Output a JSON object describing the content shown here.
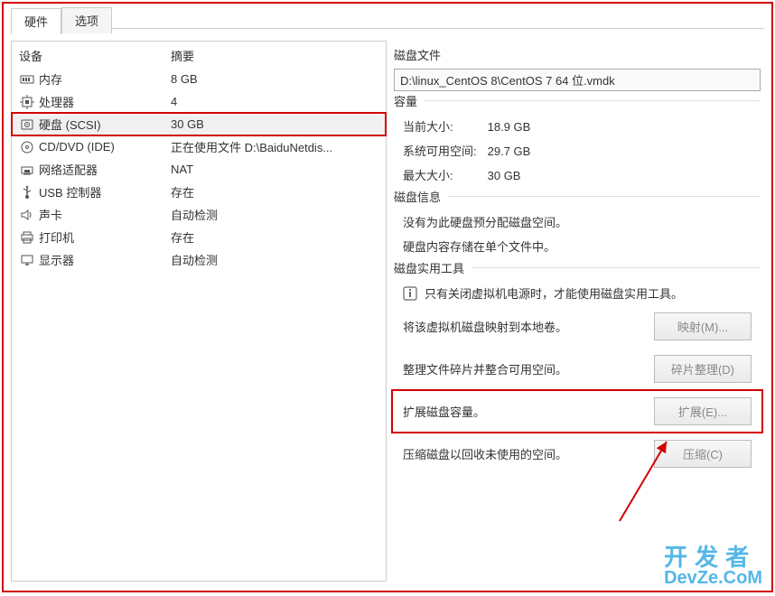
{
  "tabs": {
    "hardware": "硬件",
    "options": "选项"
  },
  "devHeader": {
    "device": "设备",
    "summary": "摘要"
  },
  "devices": [
    {
      "icon": "memory-icon",
      "name": "内存",
      "summary": "8 GB"
    },
    {
      "icon": "cpu-icon",
      "name": "处理器",
      "summary": "4"
    },
    {
      "icon": "disk-icon",
      "name": "硬盘 (SCSI)",
      "summary": "30 GB",
      "selected": true,
      "highlighted": true
    },
    {
      "icon": "cd-icon",
      "name": "CD/DVD (IDE)",
      "summary": "正在使用文件 D:\\BaiduNetdis..."
    },
    {
      "icon": "network-icon",
      "name": "网络适配器",
      "summary": "NAT"
    },
    {
      "icon": "usb-icon",
      "name": "USB 控制器",
      "summary": "存在"
    },
    {
      "icon": "sound-icon",
      "name": "声卡",
      "summary": "自动检测"
    },
    {
      "icon": "printer-icon",
      "name": "打印机",
      "summary": "存在"
    },
    {
      "icon": "display-icon",
      "name": "显示器",
      "summary": "自动检测"
    }
  ],
  "groups": {
    "diskFile": {
      "title": "磁盘文件",
      "path": "D:\\linux_CentOS 8\\CentOS 7 64 位.vmdk"
    },
    "capacity": {
      "title": "容量",
      "current": {
        "label": "当前大小:",
        "value": "18.9 GB"
      },
      "free": {
        "label": "系统可用空间:",
        "value": "29.7 GB"
      },
      "max": {
        "label": "最大大小:",
        "value": "30 GB"
      }
    },
    "diskInfo": {
      "title": "磁盘信息",
      "line1": "没有为此硬盘预分配磁盘空间。",
      "line2": "硬盘内容存储在单个文件中。"
    },
    "utilities": {
      "title": "磁盘实用工具",
      "notice": "只有关闭虚拟机电源时，才能使用磁盘实用工具。",
      "map": {
        "text": "将该虚拟机磁盘映射到本地卷。",
        "btn": "映射(M)..."
      },
      "defrag": {
        "text": "整理文件碎片并整合可用空间。",
        "btn": "碎片整理(D)"
      },
      "expand": {
        "text": "扩展磁盘容量。",
        "btn": "扩展(E)..."
      },
      "compact": {
        "text": "压缩磁盘以回收未使用的空间。",
        "btn": "压缩(C)"
      }
    }
  },
  "watermark": {
    "line1": "开发者",
    "line2": "DevZe.CoM"
  }
}
